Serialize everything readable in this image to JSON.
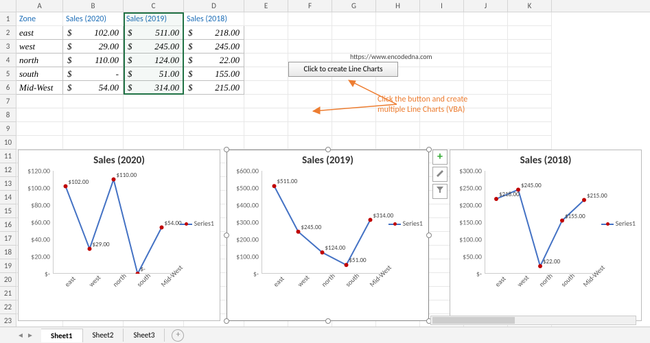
{
  "columns": [
    "A",
    "B",
    "C",
    "D",
    "E",
    "F",
    "G",
    "H",
    "I",
    "J",
    "K"
  ],
  "row_count": 23,
  "headers": {
    "A": "Zone",
    "B": "Sales (2020)",
    "C": "Sales (2019)",
    "D": "Sales (2018)"
  },
  "rows": [
    {
      "zone": "east",
      "b": "102.00",
      "c": "511.00",
      "d": "218.00"
    },
    {
      "zone": "west",
      "b": "29.00",
      "c": "245.00",
      "d": "245.00"
    },
    {
      "zone": "north",
      "b": "110.00",
      "c": "124.00",
      "d": "22.00"
    },
    {
      "zone": "south",
      "b": "-",
      "c": "51.00",
      "d": "155.00"
    },
    {
      "zone": "Mid-West",
      "b": "54.00",
      "c": "314.00",
      "d": "215.00"
    }
  ],
  "dollar": "$",
  "button_label": "Click to create Line Charts",
  "url_text": "https://www.encodedna.com",
  "annotation_line1": "Click the button and create",
  "annotation_line2": "multiple Line Charts (VBA)",
  "legend_label": "Series1",
  "tabs": {
    "active": "Sheet1",
    "others": [
      "Sheet2",
      "Sheet3"
    ]
  },
  "chart_data": [
    {
      "type": "line",
      "title": "Sales (2020)",
      "categories": [
        "east",
        "west",
        "north",
        "south",
        "Mid-West"
      ],
      "values": [
        102,
        29,
        110,
        0,
        54
      ],
      "data_labels": [
        "$102.00",
        "$29.00",
        "$110.00",
        "$-",
        "$54.00"
      ],
      "yticks": [
        "$-",
        "$20.00",
        "$40.00",
        "$60.00",
        "$80.00",
        "$100.00",
        "$120.00"
      ],
      "ymax": 120,
      "legend": "Series1"
    },
    {
      "type": "line",
      "title": "Sales (2019)",
      "categories": [
        "east",
        "west",
        "north",
        "south",
        "Mid-West"
      ],
      "values": [
        511,
        245,
        124,
        51,
        314
      ],
      "data_labels": [
        "$511.00",
        "$245.00",
        "$124.00",
        "$51.00",
        "$314.00"
      ],
      "yticks": [
        "$-",
        "$100.00",
        "$200.00",
        "$300.00",
        "$400.00",
        "$500.00",
        "$600.00"
      ],
      "ymax": 600,
      "legend": "Series1"
    },
    {
      "type": "line",
      "title": "Sales (2018)",
      "categories": [
        "east",
        "west",
        "north",
        "south",
        "Mid-West"
      ],
      "values": [
        218,
        245,
        22,
        155,
        215
      ],
      "data_labels": [
        "$218.00",
        "$245.00",
        "$22.00",
        "$155.00",
        "$215.00"
      ],
      "yticks": [
        "$-",
        "$50.00",
        "$100.00",
        "$150.00",
        "$200.00",
        "$250.00",
        "$300.00"
      ],
      "ymax": 300,
      "legend": "Series1"
    }
  ]
}
